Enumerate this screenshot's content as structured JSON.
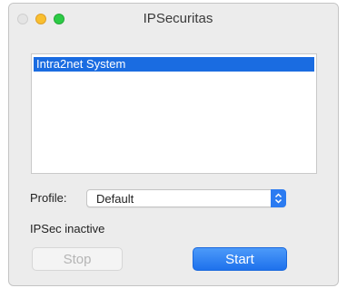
{
  "window": {
    "title": "IPSecuritas"
  },
  "connections": {
    "items": [
      {
        "label": "Intra2net System",
        "selected": true
      }
    ]
  },
  "profile": {
    "label": "Profile:",
    "value": "Default"
  },
  "status": {
    "text": "IPSec inactive"
  },
  "buttons": {
    "stop_label": "Stop",
    "start_label": "Start"
  },
  "colors": {
    "accent": "#1a6ce1",
    "selection": "#1a6ce1",
    "traffic_close": "#e4e4e4",
    "traffic_minimize": "#f9bf2f",
    "traffic_maximize": "#2ccb45"
  }
}
